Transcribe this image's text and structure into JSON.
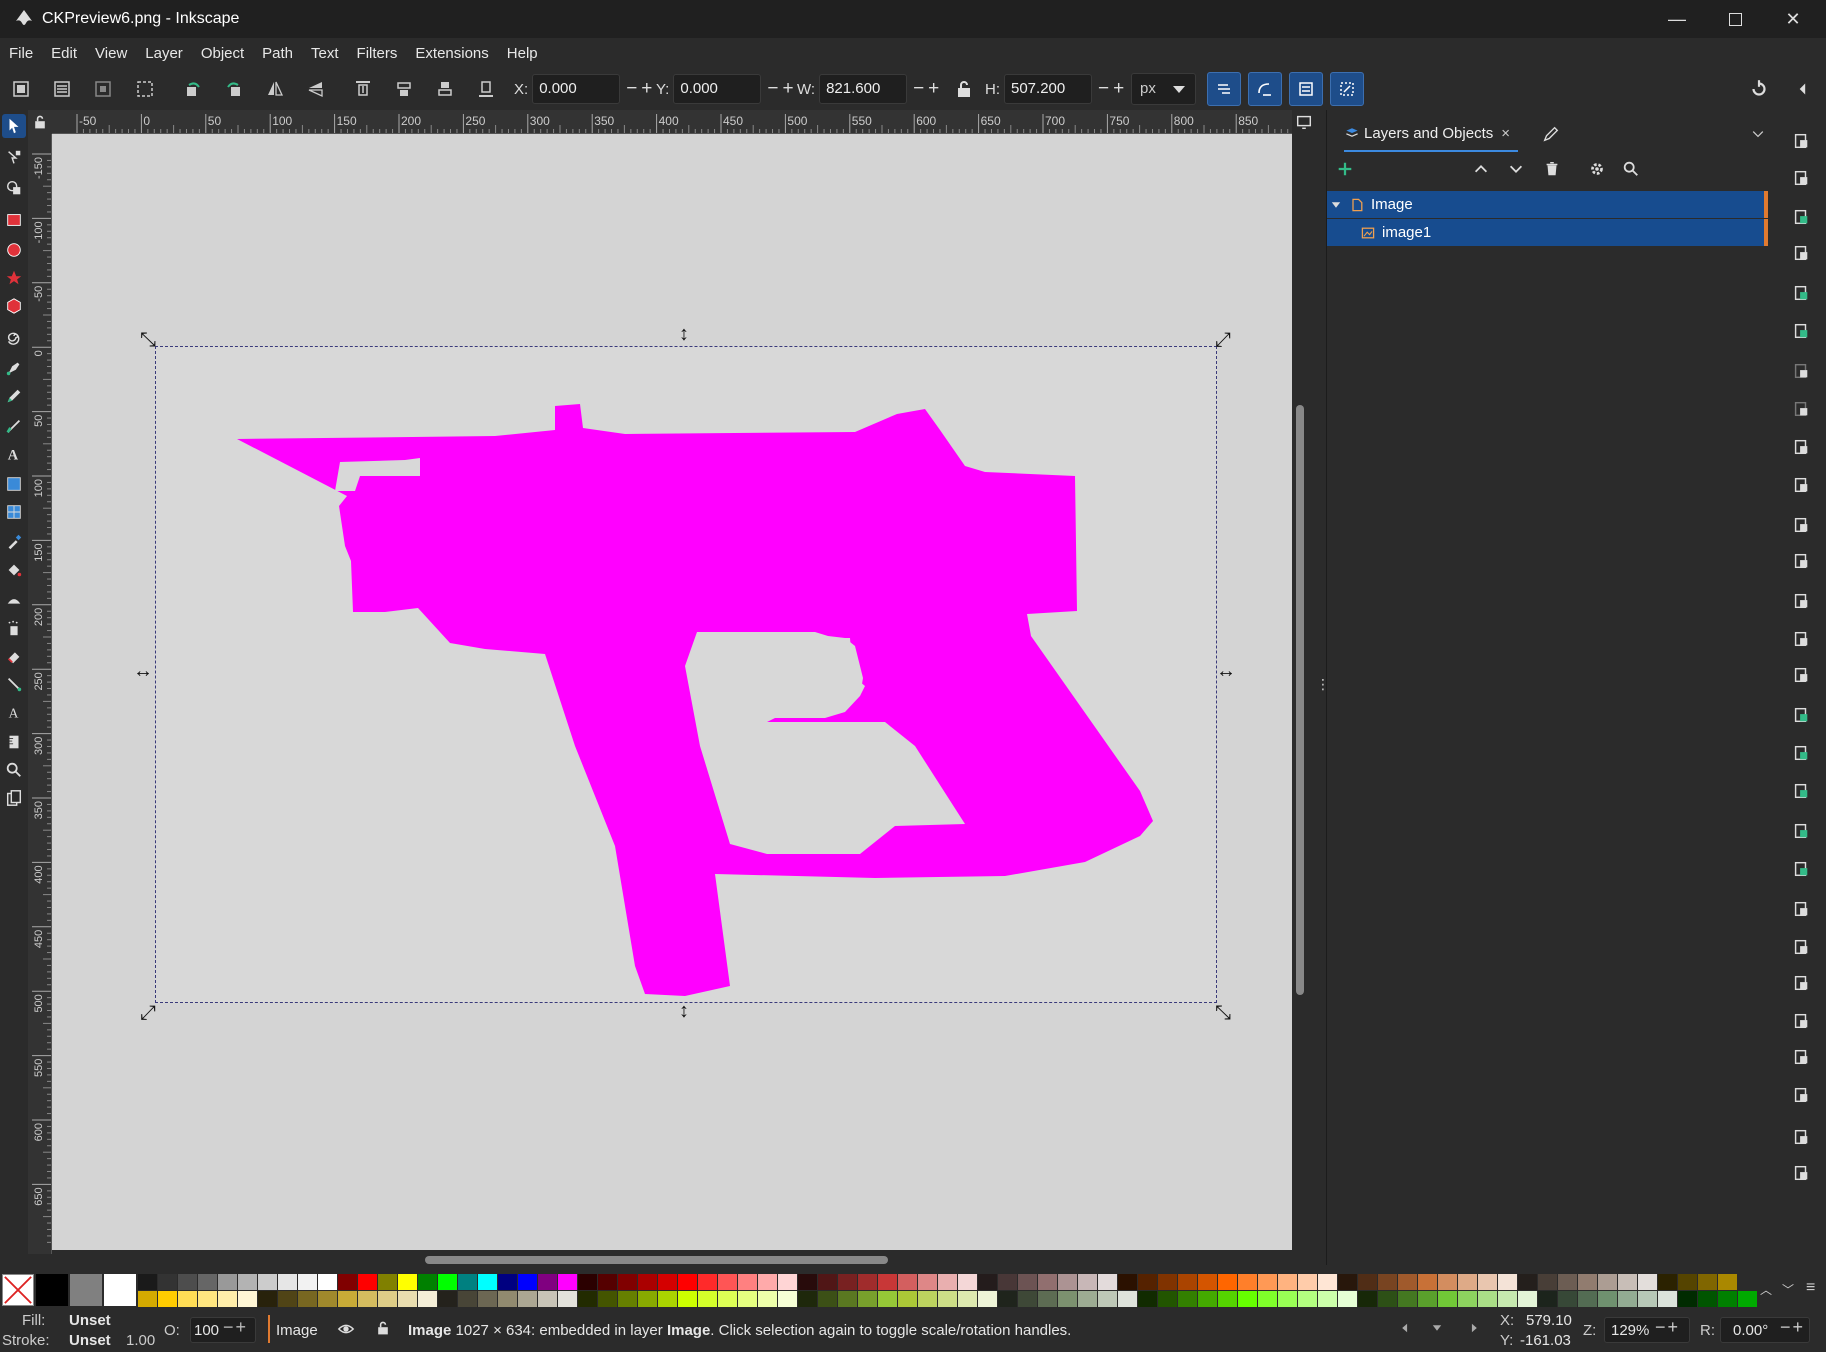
{
  "window": {
    "title": "CKPreview6.png - Inkscape"
  },
  "menu": [
    "File",
    "Edit",
    "View",
    "Layer",
    "Object",
    "Path",
    "Text",
    "Filters",
    "Extensions",
    "Help"
  ],
  "toolbar": {
    "x_label": "X:",
    "x_value": "0.000",
    "y_label": "Y:",
    "y_value": "0.000",
    "w_label": "W:",
    "w_value": "821.600",
    "h_label": "H:",
    "h_value": "507.200",
    "unit": "px",
    "plus_minus": "−+"
  },
  "ruler_top": [
    "-50",
    "0",
    "50",
    "100",
    "150",
    "200",
    "250",
    "300",
    "350",
    "400",
    "450",
    "500",
    "550",
    "600",
    "650",
    "700",
    "750",
    "800",
    "850"
  ],
  "ruler_left": [
    "-150",
    "-100",
    "-50",
    "0",
    "50",
    "100",
    "150",
    "200",
    "250",
    "300",
    "350",
    "400",
    "450",
    "500",
    "550",
    "600",
    "650"
  ],
  "dock": {
    "tab_label": "Layers and Objects",
    "tab_close": "×",
    "layers": [
      {
        "label": "Image",
        "selected": true
      },
      {
        "label": "image1",
        "selected": true
      }
    ]
  },
  "status": {
    "fill_label": "Fill:",
    "fill_value": "Unset",
    "stroke_label": "Stroke:",
    "stroke_value": "Unset",
    "stroke_width": "1.00",
    "opacity_label": "O:",
    "opacity_value": "100",
    "layer_name": "Image",
    "message_bold": "Image",
    "message_mid": " 1027 × 634: embedded in layer ",
    "message_layer": "Image",
    "message_end": ". Click selection again to toggle scale/rotation handles.",
    "cursor_x_label": "X:",
    "cursor_x": "579.10",
    "cursor_y_label": "Y:",
    "cursor_y": "-161.03",
    "zoom_label": "Z:",
    "zoom_value": "129%",
    "rotation_label": "R:",
    "rotation_value": "0.00°"
  },
  "colors": {
    "shape": "#ff00ff",
    "canvas": "#d4d4d4",
    "selection_blue": "#174c8f",
    "accent_orange": "#e07a30"
  }
}
